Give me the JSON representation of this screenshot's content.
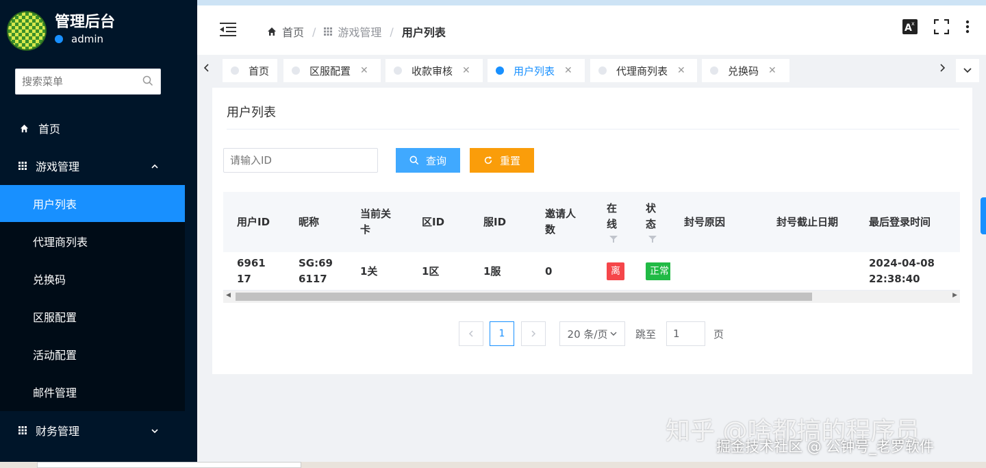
{
  "brand": {
    "title": "管理后台",
    "user": "admin"
  },
  "sidebar": {
    "search_placeholder": "搜索菜单",
    "items": [
      {
        "label": "首页",
        "icon": "home-icon"
      },
      {
        "label": "游戏管理",
        "icon": "grid-icon"
      },
      {
        "label": "用户列表"
      },
      {
        "label": "代理商列表"
      },
      {
        "label": "兑换码"
      },
      {
        "label": "区服配置"
      },
      {
        "label": "活动配置"
      },
      {
        "label": "邮件管理"
      },
      {
        "label": "财务管理",
        "icon": "grid-icon"
      }
    ]
  },
  "header": {
    "breadcrumb": [
      "首页",
      "游戏管理",
      "用户列表"
    ]
  },
  "tabs": [
    {
      "label": "首页"
    },
    {
      "label": "区服配置"
    },
    {
      "label": "收款审核"
    },
    {
      "label": "用户列表",
      "active": true
    },
    {
      "label": "代理商列表"
    },
    {
      "label": "兑换码"
    }
  ],
  "card": {
    "title": "用户列表",
    "id_placeholder": "请输入ID",
    "search_btn": "查询",
    "reset_btn": "重置"
  },
  "table": {
    "columns": [
      "用户ID",
      "昵称",
      "当前关卡",
      "区ID",
      "服ID",
      "邀请人数",
      "在线",
      "状态",
      "封号原因",
      "封号截止日期",
      "最后登录时间"
    ],
    "rows": [
      {
        "user_id": "696117",
        "nickname": "SG:696117",
        "level": "1关",
        "zone_id": "1区",
        "server_id": "1服",
        "invites": "0",
        "online": "离",
        "status": "正常",
        "ban_reason": "",
        "ban_until": "",
        "last_login": "2024-04-08 22:38:40"
      }
    ]
  },
  "pagination": {
    "current_page": "1",
    "page_size": "20 条/页",
    "jump_label": "跳至",
    "jump_value": "1",
    "page_unit": "页"
  },
  "watermark": {
    "line1": "知乎 @啥都搞的程序员",
    "line2": "掘金技术社区 @ 公钟号_老罗软件"
  },
  "colors": {
    "primary": "#1890ff",
    "sidebar": "#001529",
    "warning": "#fa9d0a",
    "danger": "#f5464a",
    "success": "#21ba45"
  }
}
